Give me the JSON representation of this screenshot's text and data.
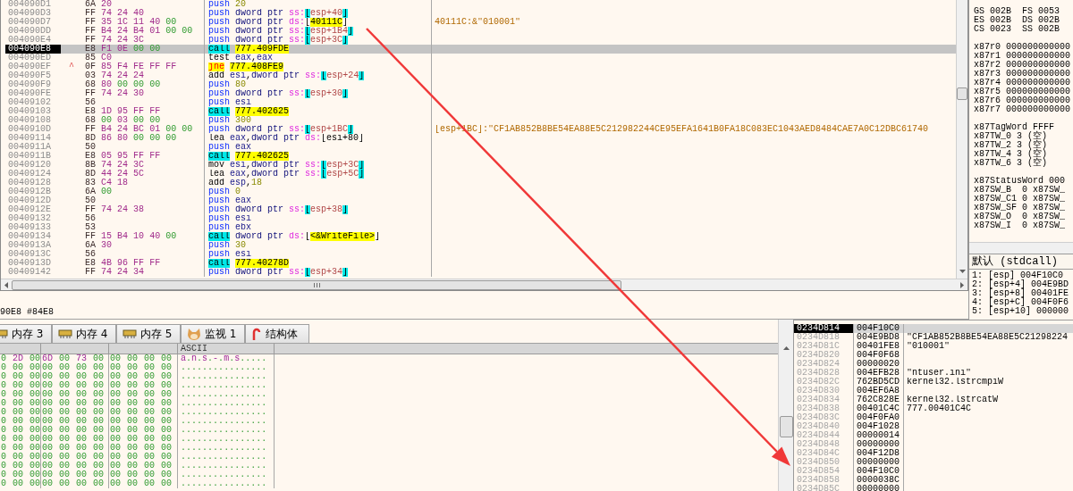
{
  "disassembly": {
    "rows": [
      {
        "address": "004090D1",
        "bytes": "6A 20",
        "selected": false,
        "instruction": [
          {
            "kind": "push",
            "text": "push"
          },
          {
            "kind": "imm",
            "text": "20"
          }
        ]
      },
      {
        "address": "004090D3",
        "bytes": "FF 74 24 40",
        "selected": false,
        "instruction": [
          {
            "kind": "push",
            "text": "push"
          },
          {
            "kind": "ptr",
            "text": "dword ptr"
          },
          {
            "kind": "seg",
            "text": "ss:"
          },
          {
            "kind": "bracket",
            "text": "["
          },
          {
            "kind": "mem",
            "text": "esp+40"
          },
          {
            "kind": "bracket",
            "text": "]"
          }
        ]
      },
      {
        "address": "004090D7",
        "bytes": "FF 35 1C 11 40 00",
        "selected": false,
        "comment": "40111C:&\"010001\"",
        "instruction": [
          {
            "kind": "push",
            "text": "push"
          },
          {
            "kind": "ptr",
            "text": "dword ptr"
          },
          {
            "kind": "seg",
            "text": "ds:"
          },
          {
            "kind": "sym",
            "text": "["
          },
          {
            "kind": "target",
            "text": "40111C"
          },
          {
            "kind": "sym",
            "text": "]"
          }
        ]
      },
      {
        "address": "004090DD",
        "bytes": "FF B4 24 B4 01 00 00",
        "selected": false,
        "instruction": [
          {
            "kind": "push",
            "text": "push"
          },
          {
            "kind": "ptr",
            "text": "dword ptr"
          },
          {
            "kind": "seg",
            "text": "ss:"
          },
          {
            "kind": "bracket",
            "text": "["
          },
          {
            "kind": "mem",
            "text": "esp+1B4"
          },
          {
            "kind": "bracket",
            "text": "]"
          }
        ]
      },
      {
        "address": "004090E4",
        "bytes": "FF 74 24 3C",
        "selected": false,
        "instruction": [
          {
            "kind": "push",
            "text": "push"
          },
          {
            "kind": "ptr",
            "text": "dword ptr"
          },
          {
            "kind": "seg",
            "text": "ss:"
          },
          {
            "kind": "bracket",
            "text": "["
          },
          {
            "kind": "mem",
            "text": "esp+3C"
          },
          {
            "kind": "bracket",
            "text": "]"
          }
        ]
      },
      {
        "address": "004090E8",
        "bytes": "E8 F1 0E 00 00",
        "selected": true,
        "instruction": [
          {
            "kind": "call",
            "text": "call"
          },
          {
            "kind": "target",
            "text": "777.409FDE"
          }
        ]
      },
      {
        "address": "004090ED",
        "bytes": "85 C0",
        "selected": false,
        "instruction": [
          {
            "kind": "op",
            "text": "test"
          },
          {
            "kind": "reg",
            "text": "eax"
          },
          {
            "kind": "sym",
            "text": ","
          },
          {
            "kind": "reg",
            "text": "eax"
          }
        ]
      },
      {
        "address": "004090EF",
        "marker": "^",
        "bytes": "0F 85 F4 FE FF FF",
        "selected": false,
        "instruction": [
          {
            "kind": "jcc",
            "text": "jne"
          },
          {
            "kind": "target",
            "text": "777.408FE9"
          }
        ]
      },
      {
        "address": "004090F5",
        "bytes": "03 74 24 24",
        "selected": false,
        "instruction": [
          {
            "kind": "op",
            "text": "add"
          },
          {
            "kind": "reg",
            "text": "esi"
          },
          {
            "kind": "sym",
            "text": ","
          },
          {
            "kind": "ptr",
            "text": "dword ptr"
          },
          {
            "kind": "seg",
            "text": "ss:"
          },
          {
            "kind": "bracket",
            "text": "["
          },
          {
            "kind": "mem",
            "text": "esp+24"
          },
          {
            "kind": "bracket",
            "text": "]"
          }
        ]
      },
      {
        "address": "004090F9",
        "bytes": "68 80 00 00 00",
        "selected": false,
        "instruction": [
          {
            "kind": "push",
            "text": "push"
          },
          {
            "kind": "imm",
            "text": "80"
          }
        ]
      },
      {
        "address": "004090FE",
        "bytes": "FF 74 24 30",
        "selected": false,
        "instruction": [
          {
            "kind": "push",
            "text": "push"
          },
          {
            "kind": "ptr",
            "text": "dword ptr"
          },
          {
            "kind": "seg",
            "text": "ss:"
          },
          {
            "kind": "bracket",
            "text": "["
          },
          {
            "kind": "mem",
            "text": "esp+30"
          },
          {
            "kind": "bracket",
            "text": "]"
          }
        ]
      },
      {
        "address": "00409102",
        "bytes": "56",
        "selected": false,
        "instruction": [
          {
            "kind": "push",
            "text": "push"
          },
          {
            "kind": "reg",
            "text": "esi"
          }
        ]
      },
      {
        "address": "00409103",
        "bytes": "E8 1D 95 FF FF",
        "selected": false,
        "instruction": [
          {
            "kind": "call",
            "text": "call"
          },
          {
            "kind": "target",
            "text": "777.402625"
          }
        ]
      },
      {
        "address": "00409108",
        "bytes": "68 00 03 00 00",
        "selected": false,
        "instruction": [
          {
            "kind": "push",
            "text": "push"
          },
          {
            "kind": "imm",
            "text": "300"
          }
        ]
      },
      {
        "address": "0040910D",
        "bytes": "FF B4 24 BC 01 00 00",
        "selected": false,
        "comment": "[esp+1BC]:\"CF1AB852B8BE54EA88E5C212982244CE95EFA1641B0FA18C083EC1043AED8484CAE7A0C12DBC61740",
        "instruction": [
          {
            "kind": "push",
            "text": "push"
          },
          {
            "kind": "ptr",
            "text": "dword ptr"
          },
          {
            "kind": "seg",
            "text": "ss:"
          },
          {
            "kind": "bracket",
            "text": "["
          },
          {
            "kind": "mem",
            "text": "esp+1BC"
          },
          {
            "kind": "bracket",
            "text": "]"
          }
        ]
      },
      {
        "address": "00409114",
        "bytes": "8D 86 80 00 00 00",
        "selected": false,
        "instruction": [
          {
            "kind": "op",
            "text": "lea"
          },
          {
            "kind": "reg",
            "text": "eax"
          },
          {
            "kind": "sym",
            "text": ","
          },
          {
            "kind": "ptr",
            "text": "dword ptr"
          },
          {
            "kind": "seg",
            "text": "ds:"
          },
          {
            "kind": "sym",
            "text": "[esi+80]"
          }
        ]
      },
      {
        "address": "0040911A",
        "bytes": "50",
        "selected": false,
        "instruction": [
          {
            "kind": "push",
            "text": "push"
          },
          {
            "kind": "reg",
            "text": "eax"
          }
        ]
      },
      {
        "address": "0040911B",
        "bytes": "E8 05 95 FF FF",
        "selected": false,
        "instruction": [
          {
            "kind": "call",
            "text": "call"
          },
          {
            "kind": "target",
            "text": "777.402625"
          }
        ]
      },
      {
        "address": "00409120",
        "bytes": "8B 74 24 3C",
        "selected": false,
        "instruction": [
          {
            "kind": "op",
            "text": "mov"
          },
          {
            "kind": "reg",
            "text": "esi"
          },
          {
            "kind": "sym",
            "text": ","
          },
          {
            "kind": "ptr",
            "text": "dword ptr"
          },
          {
            "kind": "seg",
            "text": "ss:"
          },
          {
            "kind": "bracket",
            "text": "["
          },
          {
            "kind": "mem",
            "text": "esp+3C"
          },
          {
            "kind": "bracket",
            "text": "]"
          }
        ]
      },
      {
        "address": "00409124",
        "bytes": "8D 44 24 5C",
        "selected": false,
        "instruction": [
          {
            "kind": "op",
            "text": "lea"
          },
          {
            "kind": "reg",
            "text": "eax"
          },
          {
            "kind": "sym",
            "text": ","
          },
          {
            "kind": "ptr",
            "text": "dword ptr"
          },
          {
            "kind": "seg",
            "text": "ss:"
          },
          {
            "kind": "bracket",
            "text": "["
          },
          {
            "kind": "mem",
            "text": "esp+5C"
          },
          {
            "kind": "bracket",
            "text": "]"
          }
        ]
      },
      {
        "address": "00409128",
        "bytes": "83 C4 18",
        "selected": false,
        "instruction": [
          {
            "kind": "op",
            "text": "add"
          },
          {
            "kind": "reg",
            "text": "esp"
          },
          {
            "kind": "sym",
            "text": ","
          },
          {
            "kind": "imm",
            "text": "18"
          }
        ]
      },
      {
        "address": "0040912B",
        "bytes": "6A 00",
        "selected": false,
        "instruction": [
          {
            "kind": "push",
            "text": "push"
          },
          {
            "kind": "imm",
            "text": "0"
          }
        ]
      },
      {
        "address": "0040912D",
        "bytes": "50",
        "selected": false,
        "instruction": [
          {
            "kind": "push",
            "text": "push"
          },
          {
            "kind": "reg",
            "text": "eax"
          }
        ]
      },
      {
        "address": "0040912E",
        "bytes": "FF 74 24 38",
        "selected": false,
        "instruction": [
          {
            "kind": "push",
            "text": "push"
          },
          {
            "kind": "ptr",
            "text": "dword ptr"
          },
          {
            "kind": "seg",
            "text": "ss:"
          },
          {
            "kind": "bracket",
            "text": "["
          },
          {
            "kind": "mem",
            "text": "esp+38"
          },
          {
            "kind": "bracket",
            "text": "]"
          }
        ]
      },
      {
        "address": "00409132",
        "bytes": "56",
        "selected": false,
        "instruction": [
          {
            "kind": "push",
            "text": "push"
          },
          {
            "kind": "reg",
            "text": "esi"
          }
        ]
      },
      {
        "address": "00409133",
        "bytes": "53",
        "selected": false,
        "instruction": [
          {
            "kind": "push",
            "text": "push"
          },
          {
            "kind": "reg",
            "text": "ebx"
          }
        ]
      },
      {
        "address": "00409134",
        "bytes": "FF 15 B4 10 40 00",
        "selected": false,
        "instruction": [
          {
            "kind": "call",
            "text": "call"
          },
          {
            "kind": "ptr",
            "text": "dword ptr"
          },
          {
            "kind": "seg",
            "text": "ds:"
          },
          {
            "kind": "sym",
            "text": "["
          },
          {
            "kind": "target",
            "text": "<&WriteFile>"
          },
          {
            "kind": "sym",
            "text": "]"
          }
        ]
      },
      {
        "address": "0040913A",
        "bytes": "6A 30",
        "selected": false,
        "instruction": [
          {
            "kind": "push",
            "text": "push"
          },
          {
            "kind": "imm",
            "text": "30"
          }
        ]
      },
      {
        "address": "0040913C",
        "bytes": "56",
        "selected": false,
        "instruction": [
          {
            "kind": "push",
            "text": "push"
          },
          {
            "kind": "reg",
            "text": "esi"
          }
        ]
      },
      {
        "address": "0040913D",
        "bytes": "E8 4B 96 FF FF",
        "selected": false,
        "instruction": [
          {
            "kind": "call",
            "text": "call"
          },
          {
            "kind": "target",
            "text": "777.40278D"
          }
        ]
      },
      {
        "address": "00409142",
        "bytes": "FF 74 24 34",
        "selected": false,
        "instruction": [
          {
            "kind": "push",
            "text": "push"
          },
          {
            "kind": "ptr",
            "text": "dword ptr"
          },
          {
            "kind": "seg",
            "text": "ss:"
          },
          {
            "kind": "bracket",
            "text": "["
          },
          {
            "kind": "mem",
            "text": "esp+34"
          },
          {
            "kind": "bracket",
            "text": "]"
          }
        ]
      }
    ]
  },
  "status_line": "90E8 #84E8",
  "registers": {
    "groups": [
      [
        [
          "GS 002B",
          "FS 0053"
        ],
        [
          "ES 002B",
          "DS 002B"
        ],
        [
          "CS 0023",
          "SS 002B"
        ]
      ],
      [
        [
          "x87r0 000000000000"
        ],
        [
          "x87r1 000000000000"
        ],
        [
          "x87r2 000000000000"
        ],
        [
          "x87r3 000000000000"
        ],
        [
          "x87r4 000000000000"
        ],
        [
          "x87r5 000000000000"
        ],
        [
          "x87r6 000000000000"
        ],
        [
          "x87r7 000000000000"
        ]
      ],
      [
        [
          "x87TagWord FFFF"
        ],
        [
          "x87TW_0 3 (空)"
        ],
        [
          "x87TW_2 3 (空)"
        ],
        [
          "x87TW_4 3 (空)"
        ],
        [
          "x87TW_6 3 (空)"
        ]
      ],
      [
        [
          "x87StatusWord 000"
        ],
        [
          "x87SW_B",
          "0",
          "x87SW_"
        ],
        [
          "x87SW_C1",
          "0",
          "x87SW_"
        ],
        [
          "x87SW_SF",
          "0",
          "x87SW_"
        ],
        [
          "x87SW_O",
          "0",
          "x87SW_"
        ],
        [
          "x87SW_I",
          "0",
          "x87SW_"
        ]
      ]
    ]
  },
  "call_stack": {
    "title": "默认 (stdcall)",
    "rows": [
      "1: [esp] 004F10C0",
      "2: [esp+4] 004E9BD",
      "3: [esp+8] 00401FE",
      "4: [esp+C] 004F0F6",
      "5: [esp+10] 000000"
    ]
  },
  "tabs": [
    {
      "label": "内存 3",
      "kind": "memory",
      "selected": false
    },
    {
      "label": "内存 4",
      "kind": "memory",
      "selected": false
    },
    {
      "label": "内存 5",
      "kind": "memory",
      "selected": false
    },
    {
      "label": "监视 1",
      "kind": "watch",
      "selected": false
    },
    {
      "label": "结构体",
      "kind": "struct",
      "selected": false
    }
  ],
  "dump": {
    "ascii_header": "ASCII",
    "rows": [
      {
        "hex": [
          "0 2D 00",
          "6D 00 73 00",
          "00 00 00 00"
        ],
        "ascii": "a.n.s.-.m.s....."
      },
      {
        "hex": [
          "0 00 00",
          "00 00 00 00",
          "00 00 00 00"
        ],
        "ascii": "................"
      },
      {
        "hex": [
          "0 00 00",
          "00 00 00 00",
          "00 00 00 00"
        ],
        "ascii": "................"
      },
      {
        "hex": [
          "0 00 00",
          "00 00 00 00",
          "00 00 00 00"
        ],
        "ascii": "................"
      },
      {
        "hex": [
          "0 00 00",
          "00 00 00 00",
          "00 00 00 00"
        ],
        "ascii": "................"
      },
      {
        "hex": [
          "0 00 00",
          "00 00 00 00",
          "00 00 00 00"
        ],
        "ascii": "................"
      },
      {
        "hex": [
          "0 00 00",
          "00 00 00 00",
          "00 00 00 00"
        ],
        "ascii": "................"
      },
      {
        "hex": [
          "0 00 00",
          "00 00 00 00",
          "00 00 00 00"
        ],
        "ascii": "................"
      },
      {
        "hex": [
          "0 00 00",
          "00 00 00 00",
          "00 00 00 00"
        ],
        "ascii": "................"
      },
      {
        "hex": [
          "0 00 00",
          "00 00 00 00",
          "00 00 00 00"
        ],
        "ascii": "................"
      },
      {
        "hex": [
          "0 00 00",
          "00 00 00 00",
          "00 00 00 00"
        ],
        "ascii": "................"
      },
      {
        "hex": [
          "0 00 00",
          "00 00 00 00",
          "00 00 00 00"
        ],
        "ascii": "................"
      },
      {
        "hex": [
          "0 00 00",
          "00 00 00 00",
          "00 00 00 00"
        ],
        "ascii": "................"
      },
      {
        "hex": [
          "0 00 00",
          "00 00 00 00",
          "00 00 00 00"
        ],
        "ascii": "................"
      },
      {
        "hex": [
          "0 00 00",
          "00 00 00 00",
          "00 00 00 00"
        ],
        "ascii": "................"
      }
    ]
  },
  "stack": {
    "rows": [
      {
        "address": "0234D814",
        "value": "004F10C0",
        "selected": true
      },
      {
        "address": "0234D818",
        "value": "004E9BD8",
        "comment": "\"CF1AB852B8BE54EA88E5C21298224",
        "selected": false
      },
      {
        "address": "0234D81C",
        "value": "00401FE8",
        "comment": "\"010001\"",
        "selected": false
      },
      {
        "address": "0234D820",
        "value": "004F0F68",
        "selected": false
      },
      {
        "address": "0234D824",
        "value": "00000020",
        "selected": false
      },
      {
        "address": "0234D828",
        "value": "004EFB28",
        "comment": "\"ntuser.ini\"",
        "selected": false
      },
      {
        "address": "0234D82C",
        "value": "762BD5CD",
        "comment": "kernel32.lstrcmpiW",
        "selected": false
      },
      {
        "address": "0234D830",
        "value": "004EF6A8",
        "selected": false
      },
      {
        "address": "0234D834",
        "value": "762C828E",
        "comment": "kernel32.lstrcatW",
        "selected": false
      },
      {
        "address": "0234D838",
        "value": "00401C4C",
        "comment": "777.00401C4C",
        "selected": false
      },
      {
        "address": "0234D83C",
        "value": "004F0FA0",
        "selected": false
      },
      {
        "address": "0234D840",
        "value": "004F1028",
        "selected": false
      },
      {
        "address": "0234D844",
        "value": "00000014",
        "selected": false
      },
      {
        "address": "0234D848",
        "value": "00000000",
        "selected": false
      },
      {
        "address": "0234D84C",
        "value": "004F12D8",
        "selected": false
      },
      {
        "address": "0234D850",
        "value": "00000000",
        "selected": false
      },
      {
        "address": "0234D854",
        "value": "004F10C0",
        "selected": false
      },
      {
        "address": "0234D858",
        "value": "0000038C",
        "selected": false
      },
      {
        "address": "0234D85C",
        "value": "00000000",
        "selected": false
      }
    ]
  }
}
